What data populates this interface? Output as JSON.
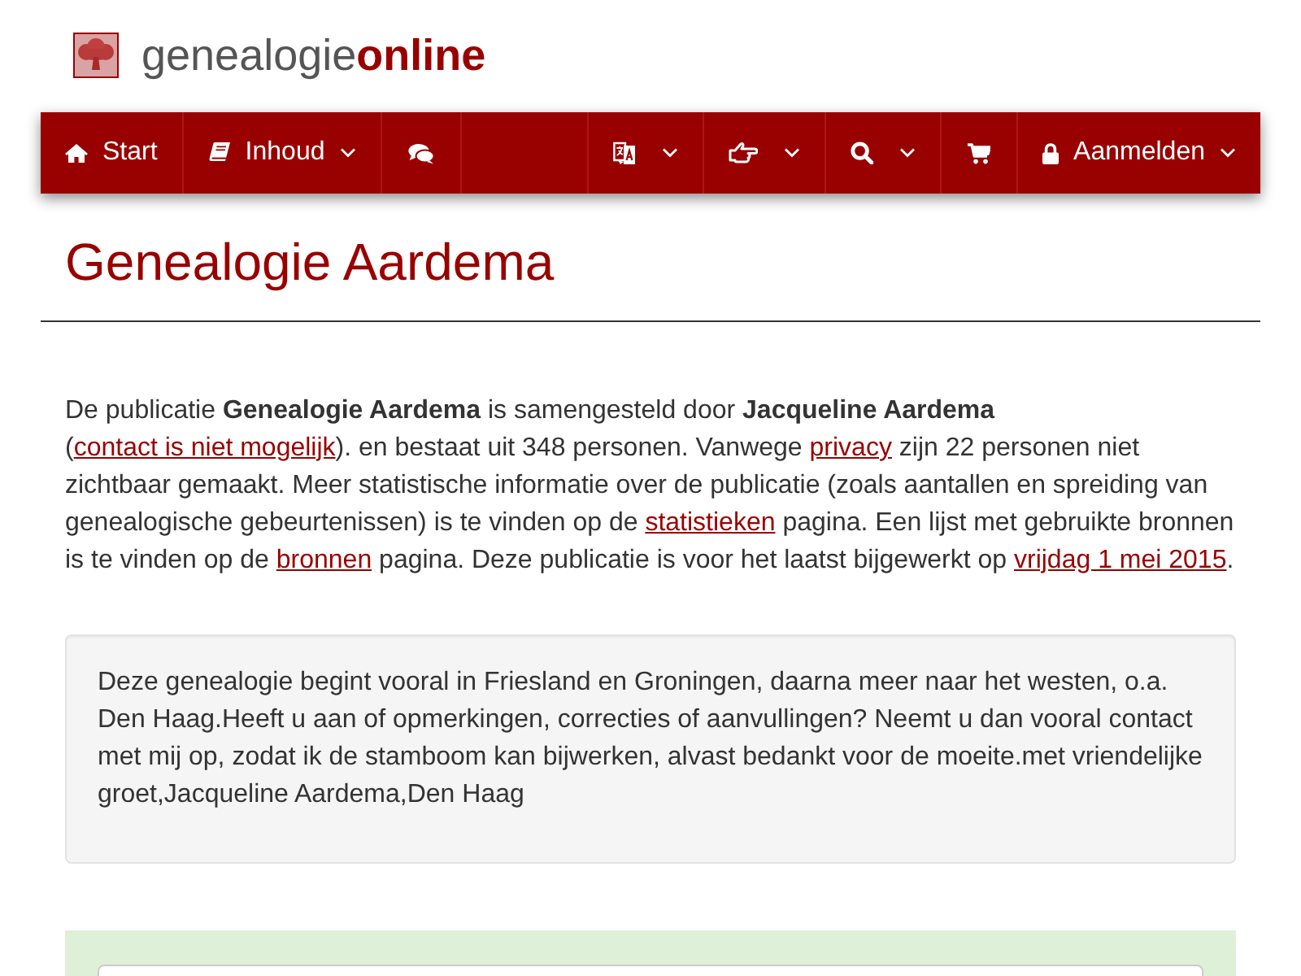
{
  "site": {
    "name": "genealogie**online**"
  },
  "nav": {
    "left": [
      {
        "label": "Start",
        "dropdown": false
      },
      {
        "label": "Inhoud",
        "dropdown": true
      },
      {
        "dropdown": false
      }
    ],
    "right": [
      {
        "dropdown": true
      },
      {
        "dropdown": true
      },
      {
        "dropdown": true
      },
      {
        "dropdown": false
      },
      {
        "label": "Aanmelden",
        "dropdown": true
      }
    ]
  },
  "page": {
    "title": "Genealogie Aardema"
  },
  "intro": [
    {
      "kind": "text",
      "text": "De publicatie **Genealogie Aardema** is samengesteld door **Jacqueline Aardema** ("
    },
    {
      "kind": "link",
      "text": "contact is niet mogelijk"
    },
    {
      "kind": "text",
      "text": "). en bestaat uit 348 personen. Vanwege "
    },
    {
      "kind": "link",
      "text": "privacy"
    },
    {
      "kind": "text",
      "text": " zijn 22 personen niet zichtbaar gemaakt. Meer statistische informatie over de publicatie (zoals aantallen en spreiding van genealogische gebeurtenissen) is te vinden op de "
    },
    {
      "kind": "link",
      "text": "statistieken"
    },
    {
      "kind": "text",
      "text": " pagina. Een lijst met gebruikte bronnen is te vinden op de "
    },
    {
      "kind": "link",
      "text": "bronnen"
    },
    {
      "kind": "text",
      "text": " pagina. Deze publicatie is voor het laatst bijgewerkt op "
    },
    {
      "kind": "link",
      "text": "vrijdag 1 mei 2015"
    },
    {
      "kind": "text",
      "text": "."
    }
  ],
  "description": {
    "text": "Deze genealogie begint vooral in Friesland en Groningen, daarna meer naar het westen, o.a. Den Haag.Heeft u aan of opmerkingen, correcties of aanvullingen? Neemt u dan vooral contact met mij op, zodat ik de stamboom kan bijwerken, alvast bedankt voor de moeite.met vriendelijke groet,Jacqueline Aardema,Den Haag"
  }
}
